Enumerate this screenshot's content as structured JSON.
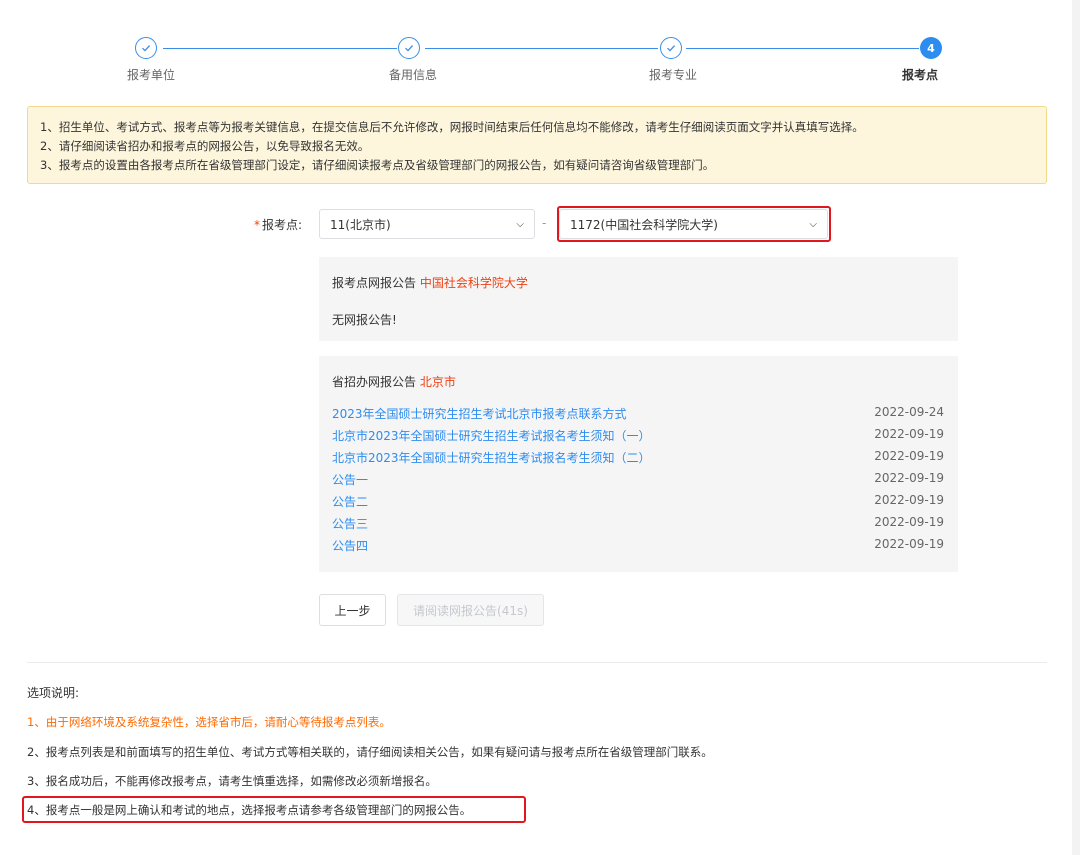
{
  "stepper": {
    "steps": [
      {
        "label": "报考单位",
        "status": "done"
      },
      {
        "label": "备用信息",
        "status": "done"
      },
      {
        "label": "报考专业",
        "status": "done"
      },
      {
        "label": "报考点",
        "status": "active",
        "number": "4"
      }
    ]
  },
  "notice": {
    "lines": [
      "1、招生单位、考试方式、报考点等为报考关键信息，在提交信息后不允许修改，网报时间结束后任何信息均不能修改，请考生仔细阅读页面文字并认真填写选择。",
      "2、请仔细阅读省招办和报考点的网报公告，以免导致报名无效。",
      "3、报考点的设置由各报考点所在省级管理部门设定，请仔细阅读报考点及省级管理部门的网报公告，如有疑问请咨询省级管理部门。"
    ]
  },
  "form": {
    "required_mark": "*",
    "label": "报考点:",
    "province_select": "11(北京市)",
    "separator": "-",
    "site_select": "1172(中国社会科学院大学)"
  },
  "site_panel": {
    "title": "报考点网报公告",
    "title_highlight": "中国社会科学院大学",
    "empty_text": "无网报公告!"
  },
  "province_panel": {
    "title": "省招办网报公告",
    "title_highlight": "北京市",
    "items": [
      {
        "title": "2023年全国硕士研究生招生考试北京市报考点联系方式",
        "date": "2022-09-24"
      },
      {
        "title": "北京市2023年全国硕士研究生招生考试报名考生须知（一）",
        "date": "2022-09-19"
      },
      {
        "title": "北京市2023年全国硕士研究生招生考试报名考生须知（二）",
        "date": "2022-09-19"
      },
      {
        "title": "公告一",
        "date": "2022-09-19"
      },
      {
        "title": "公告二",
        "date": "2022-09-19"
      },
      {
        "title": "公告三",
        "date": "2022-09-19"
      },
      {
        "title": "公告四",
        "date": "2022-09-19"
      }
    ]
  },
  "buttons": {
    "prev": "上一步",
    "read": "请阅读网报公告(41s)"
  },
  "notes": {
    "title": "选项说明:",
    "items": [
      "1、由于网络环境及系统复杂性，选择省市后，请耐心等待报考点列表。",
      "2、报考点列表是和前面填写的招生单位、考试方式等相关联的，请仔细阅读相关公告，如果有疑问请与报考点所在省级管理部门联系。",
      "3、报名成功后，不能再修改报考点，请考生慎重选择，如需修改必须新增报名。",
      "4、报考点一般是网上确认和考试的地点，选择报考点请参考各级管理部门的网报公告。"
    ]
  },
  "colors": {
    "accent": "#2d8cf0",
    "highlight_red": "#e0171f",
    "warning_orange": "#ff6a00",
    "notice_bg": "#fdf6dd"
  }
}
